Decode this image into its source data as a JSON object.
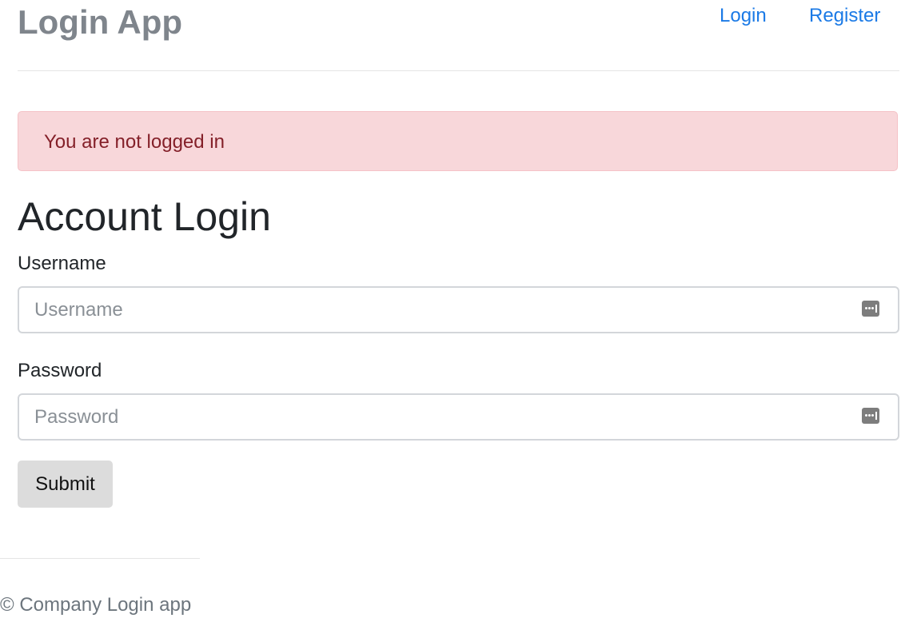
{
  "header": {
    "brand": "Login App",
    "nav": {
      "login": "Login",
      "register": "Register"
    }
  },
  "alert": {
    "message": "You are not logged in"
  },
  "form": {
    "title": "Account Login",
    "username": {
      "label": "Username",
      "placeholder": "Username",
      "value": ""
    },
    "password": {
      "label": "Password",
      "placeholder": "Password",
      "value": ""
    },
    "submit_label": "Submit",
    "field_icon": "password-manager-icon"
  },
  "footer": {
    "text": "© Company Login app"
  },
  "colors": {
    "brand_text": "#7f858c",
    "link": "#1b7ae6",
    "alert_background": "#f8d7da",
    "alert_text": "#842029",
    "submit_background": "#dcdcdc",
    "footer_text": "#6c757d"
  }
}
